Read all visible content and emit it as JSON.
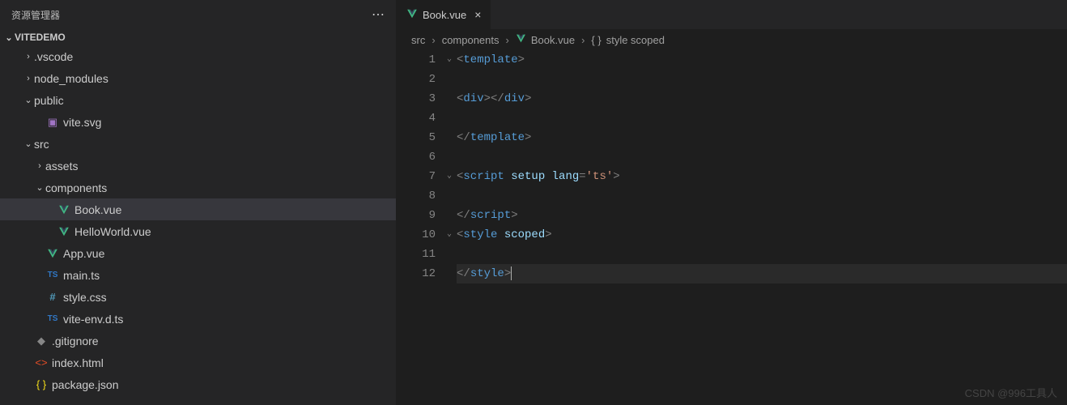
{
  "sidebar": {
    "title": "资源管理器",
    "project_name": "VITEDEMO",
    "items": [
      {
        "label": ".vscode",
        "type": "folder",
        "expanded": false,
        "indent": 1
      },
      {
        "label": "node_modules",
        "type": "folder",
        "expanded": false,
        "indent": 1
      },
      {
        "label": "public",
        "type": "folder",
        "expanded": true,
        "indent": 1
      },
      {
        "label": "vite.svg",
        "type": "img",
        "indent": 2
      },
      {
        "label": "src",
        "type": "folder",
        "expanded": true,
        "indent": 1
      },
      {
        "label": "assets",
        "type": "folder",
        "expanded": false,
        "indent": 2
      },
      {
        "label": "components",
        "type": "folder",
        "expanded": true,
        "indent": 2
      },
      {
        "label": "Book.vue",
        "type": "vue",
        "indent": 3,
        "selected": true
      },
      {
        "label": "HelloWorld.vue",
        "type": "vue",
        "indent": 3
      },
      {
        "label": "App.vue",
        "type": "vue",
        "indent": 2
      },
      {
        "label": "main.ts",
        "type": "ts",
        "indent": 2
      },
      {
        "label": "style.css",
        "type": "css",
        "indent": 2
      },
      {
        "label": "vite-env.d.ts",
        "type": "ts",
        "indent": 2
      },
      {
        "label": ".gitignore",
        "type": "git",
        "indent": 1
      },
      {
        "label": "index.html",
        "type": "html",
        "indent": 1
      },
      {
        "label": "package.json",
        "type": "json",
        "indent": 1
      }
    ]
  },
  "tabs": [
    {
      "label": "Book.vue"
    }
  ],
  "breadcrumbs": {
    "seg1": "src",
    "seg2": "components",
    "seg3": "Book.vue",
    "seg4": "style scoped"
  },
  "code": {
    "lines": [
      {
        "n": "1",
        "tokens": [
          {
            "t": "<",
            "c": "tag-bracket"
          },
          {
            "t": "template",
            "c": "tag-name"
          },
          {
            "t": ">",
            "c": "tag-bracket"
          }
        ],
        "fold": "v"
      },
      {
        "n": "2",
        "tokens": []
      },
      {
        "n": "3",
        "tokens": [
          {
            "t": "<",
            "c": "tag-bracket"
          },
          {
            "t": "div",
            "c": "tag-name"
          },
          {
            "t": "></",
            "c": "tag-bracket"
          },
          {
            "t": "div",
            "c": "tag-name"
          },
          {
            "t": ">",
            "c": "tag-bracket"
          }
        ]
      },
      {
        "n": "4",
        "tokens": []
      },
      {
        "n": "5",
        "tokens": [
          {
            "t": "</",
            "c": "tag-bracket"
          },
          {
            "t": "template",
            "c": "tag-name"
          },
          {
            "t": ">",
            "c": "tag-bracket"
          }
        ]
      },
      {
        "n": "6",
        "tokens": []
      },
      {
        "n": "7",
        "tokens": [
          {
            "t": "<",
            "c": "tag-bracket"
          },
          {
            "t": "script",
            "c": "tag-name"
          },
          {
            "t": " setup lang",
            "c": "attr-name"
          },
          {
            "t": "=",
            "c": "tag-bracket"
          },
          {
            "t": "'ts'",
            "c": "string"
          },
          {
            "t": ">",
            "c": "tag-bracket"
          }
        ],
        "fold": "v"
      },
      {
        "n": "8",
        "tokens": []
      },
      {
        "n": "9",
        "tokens": [
          {
            "t": "</",
            "c": "tag-bracket"
          },
          {
            "t": "script",
            "c": "tag-name"
          },
          {
            "t": ">",
            "c": "tag-bracket"
          }
        ]
      },
      {
        "n": "10",
        "tokens": [
          {
            "t": "<",
            "c": "tag-bracket"
          },
          {
            "t": "style",
            "c": "tag-name"
          },
          {
            "t": " scoped",
            "c": "attr-name"
          },
          {
            "t": ">",
            "c": "tag-bracket"
          }
        ],
        "fold": "v"
      },
      {
        "n": "11",
        "tokens": []
      },
      {
        "n": "12",
        "tokens": [
          {
            "t": "</",
            "c": "tag-bracket"
          },
          {
            "t": "style",
            "c": "tag-name"
          },
          {
            "t": ">",
            "c": "tag-bracket"
          }
        ],
        "cursor": true,
        "current": true
      }
    ]
  },
  "watermark": "CSDN @996工具人"
}
